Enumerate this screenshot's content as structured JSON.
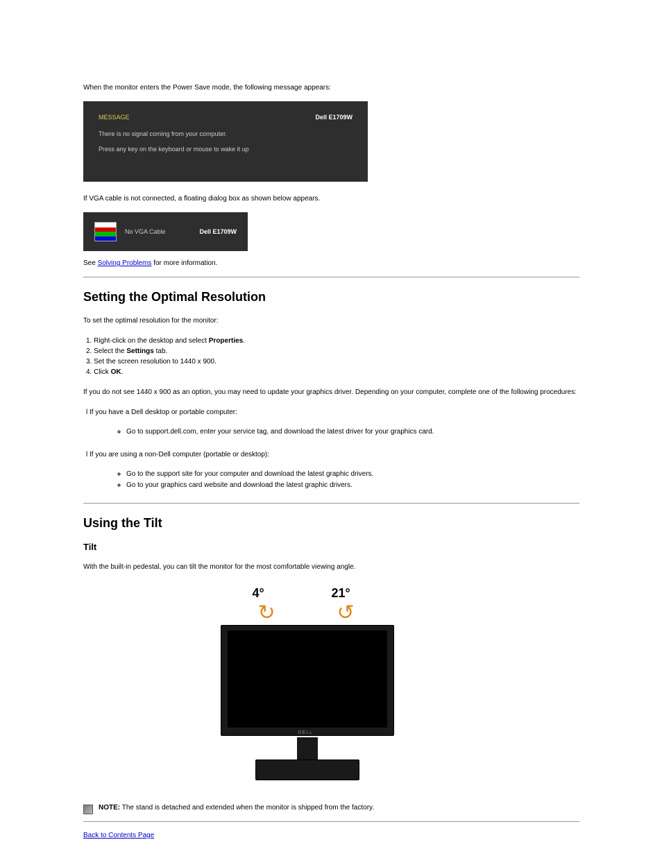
{
  "intro": "When the monitor enters the Power Save mode, the following message appears:",
  "osd1": {
    "msg_label": "MESSAGE",
    "model": "Dell E1709W",
    "line1": "There is no signal coming from your computer.",
    "line2": "Press any key on the keyboard or mouse to wake it up"
  },
  "between": "If VGA cable is not connected, a floating dialog box as shown below appears.",
  "osd2": {
    "no_vga": "No VGA Cable",
    "model": "Dell E1709W"
  },
  "see": {
    "prefix": "See ",
    "link": "Solving Problems",
    "suffix": " for more information."
  },
  "h2": "Setting the Optimal Resolution",
  "para1": "To set the optimal resolution for the monitor:",
  "steps": {
    "s1_prefix": "1. Right-click on the desktop and select ",
    "s1_bold": "Properties",
    "s1_suffix": ".",
    "s2_prefix": "2. Select the ",
    "s2_bold": "Settings",
    "s2_suffix": " tab.",
    "s3": "3. Set the screen resolution to 1440 x 900.",
    "s4_prefix": "4. Click ",
    "s4_bold": "OK",
    "s4_suffix": "."
  },
  "para2": "If you do not see 1440 x 900 as an option, you may need to update your graphics driver. Depending on your computer, complete one of the following procedures:",
  "list1": {
    "lead": "l If you have a Dell desktop or portable computer:",
    "sub1": "Go to support.dell.com, enter your service tag, and download the latest driver for your graphics card."
  },
  "list2": {
    "lead": "l If you are using a non-Dell computer (portable or desktop):",
    "sub1": "Go to the support site for your computer and download the latest graphic drivers.",
    "sub2": "Go to your graphics card website and download the latest graphic drivers."
  },
  "h3": "Using the Tilt",
  "tilt_h4": "Tilt",
  "tilt_para": "With the built-in pedestal, you can tilt the monitor for the most comfortable viewing angle.",
  "angle_left": "4°",
  "angle_right": "21°",
  "monitor_logo": "DELL",
  "note": {
    "bold": "NOTE:",
    "text": " The stand is detached and extended when the monitor is shipped from the factory."
  },
  "back_link": "Back to Contents Page"
}
